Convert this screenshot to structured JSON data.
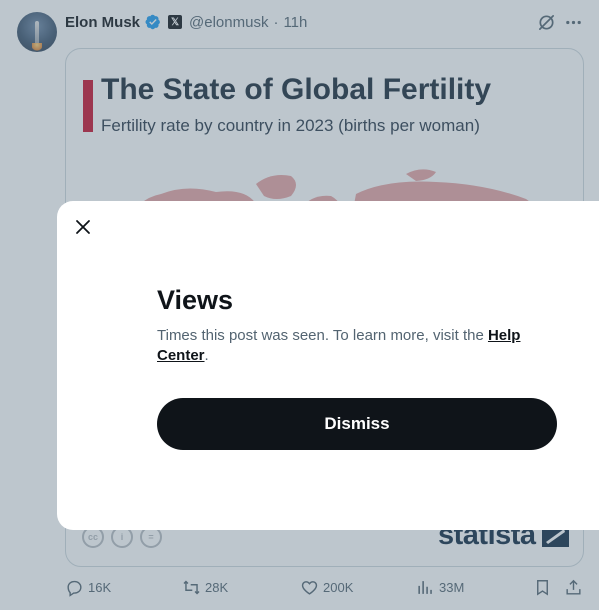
{
  "tweet": {
    "author_name": "Elon Musk",
    "handle": "@elonmusk",
    "separator": "·",
    "time": "11h",
    "icons": [
      "verified-badge-icon",
      "x-affiliate-icon",
      "grok-icon",
      "more-icon"
    ]
  },
  "media": {
    "title": "The State of Global Fertility",
    "subtitle": "Fertility rate by country in 2023 (births per woman)",
    "brand": "statista",
    "license_icons": [
      "cc-icon",
      "attribution-icon",
      "no-derivatives-icon"
    ],
    "accent_color": "#c8102e"
  },
  "actions": {
    "replies": "16K",
    "reposts": "28K",
    "likes": "200K",
    "views": "33M"
  },
  "modal": {
    "title": "Views",
    "description": "Times this post was seen. To learn more, visit the ",
    "link_text": "Help Center",
    "description_end": ".",
    "dismiss_label": "Dismiss"
  }
}
